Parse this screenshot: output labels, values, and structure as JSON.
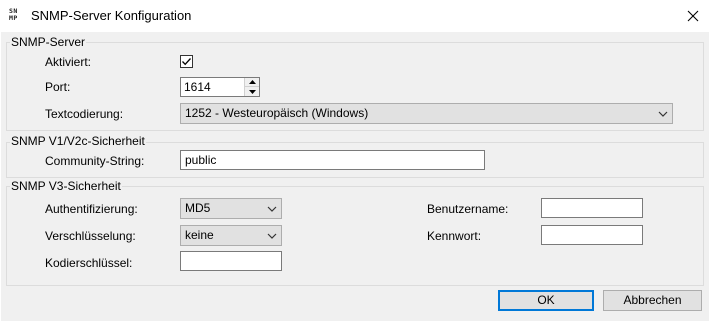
{
  "window": {
    "icon_text_top": "SN",
    "icon_text_bottom": "MP",
    "title": "SNMP-Server Konfiguration",
    "close_icon": "close-icon"
  },
  "snmp_server": {
    "group_title": "SNMP-Server",
    "enabled_label": "Aktiviert:",
    "enabled_checked": true,
    "port_label": "Port:",
    "port_value": "1614",
    "encoding_label": "Textcodierung:",
    "encoding_value": "1252 - Westeuropäisch (Windows)"
  },
  "v1v2c": {
    "group_title": "SNMP V1/V2c-Sicherheit",
    "community_label": "Community-String:",
    "community_value": "public"
  },
  "v3": {
    "group_title": "SNMP V3-Sicherheit",
    "auth_label": "Authentifizierung:",
    "auth_value": "MD5",
    "encryption_label": "Verschlüsselung:",
    "encryption_value": "keine",
    "key_label": "Kodierschlüssel:",
    "key_value": "",
    "username_label": "Benutzername:",
    "username_value": "",
    "password_label": "Kennwort:",
    "password_value": ""
  },
  "buttons": {
    "ok_label": "OK",
    "cancel_label": "Abbrechen"
  },
  "colors": {
    "accent": "#0078d7",
    "background": "#f0f0f0"
  }
}
